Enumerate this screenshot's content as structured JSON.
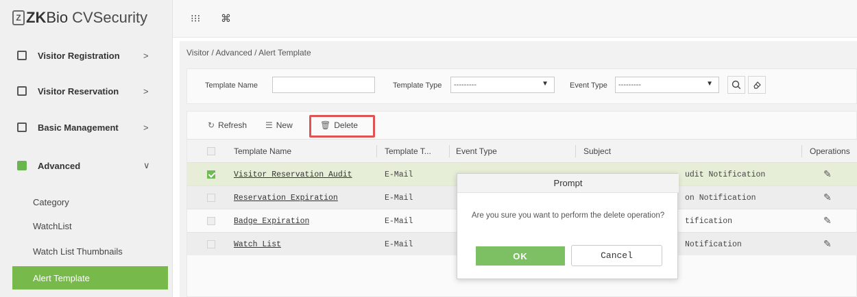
{
  "app": {
    "logo_mark": "Z",
    "logo_zk": "ZK",
    "logo_bio": "Bio",
    "logo_product": "CVSecurity",
    "top_icons": [
      "grid-icon",
      "command-icon"
    ]
  },
  "sidebar": {
    "items": [
      {
        "label": "Visitor Registration",
        "icon": "registration-icon",
        "arrow": ">"
      },
      {
        "label": "Visitor Reservation",
        "icon": "reservation-icon",
        "arrow": ">"
      },
      {
        "label": "Basic Management",
        "icon": "management-icon",
        "arrow": ">"
      },
      {
        "label": "Advanced",
        "icon": "advanced-icon",
        "arrow": "∨"
      }
    ],
    "sub_items": [
      {
        "label": "Category",
        "active": false
      },
      {
        "label": "WatchList",
        "active": false
      },
      {
        "label": "Watch List Thumbnails",
        "active": false
      },
      {
        "label": "Alert Template",
        "active": true
      }
    ]
  },
  "breadcrumb": "Visitor / Advanced / Alert Template",
  "search": {
    "template_name_label": "Template Name",
    "template_name_value": "",
    "template_type_label": "Template Type",
    "template_type_value": "---------",
    "event_type_label": "Event Type",
    "event_type_value": "---------"
  },
  "toolbar": {
    "refresh": "Refresh",
    "new": "New",
    "delete": "Delete"
  },
  "table": {
    "columns": [
      "Template Name",
      "Template T...",
      "Event Type",
      "Subject",
      "Operations"
    ],
    "rows": [
      {
        "name": "Visitor Reservation Audit",
        "type": "E-Mail",
        "subject": "udit Notification",
        "checked": true
      },
      {
        "name": "Reservation Expiration",
        "type": "E-Mail",
        "subject": "on Notification",
        "checked": false
      },
      {
        "name": "Badge Expiration",
        "type": "E-Mail",
        "subject": "tification",
        "checked": false
      },
      {
        "name": "Watch List",
        "type": "E-Mail",
        "subject": "Notification",
        "checked": false
      }
    ]
  },
  "modal": {
    "title": "Prompt",
    "message": "Are you sure you want to perform the delete operation?",
    "ok": "OK",
    "cancel": "Cancel"
  },
  "colors": {
    "accent": "#78b94c",
    "highlight": "#e05354"
  }
}
